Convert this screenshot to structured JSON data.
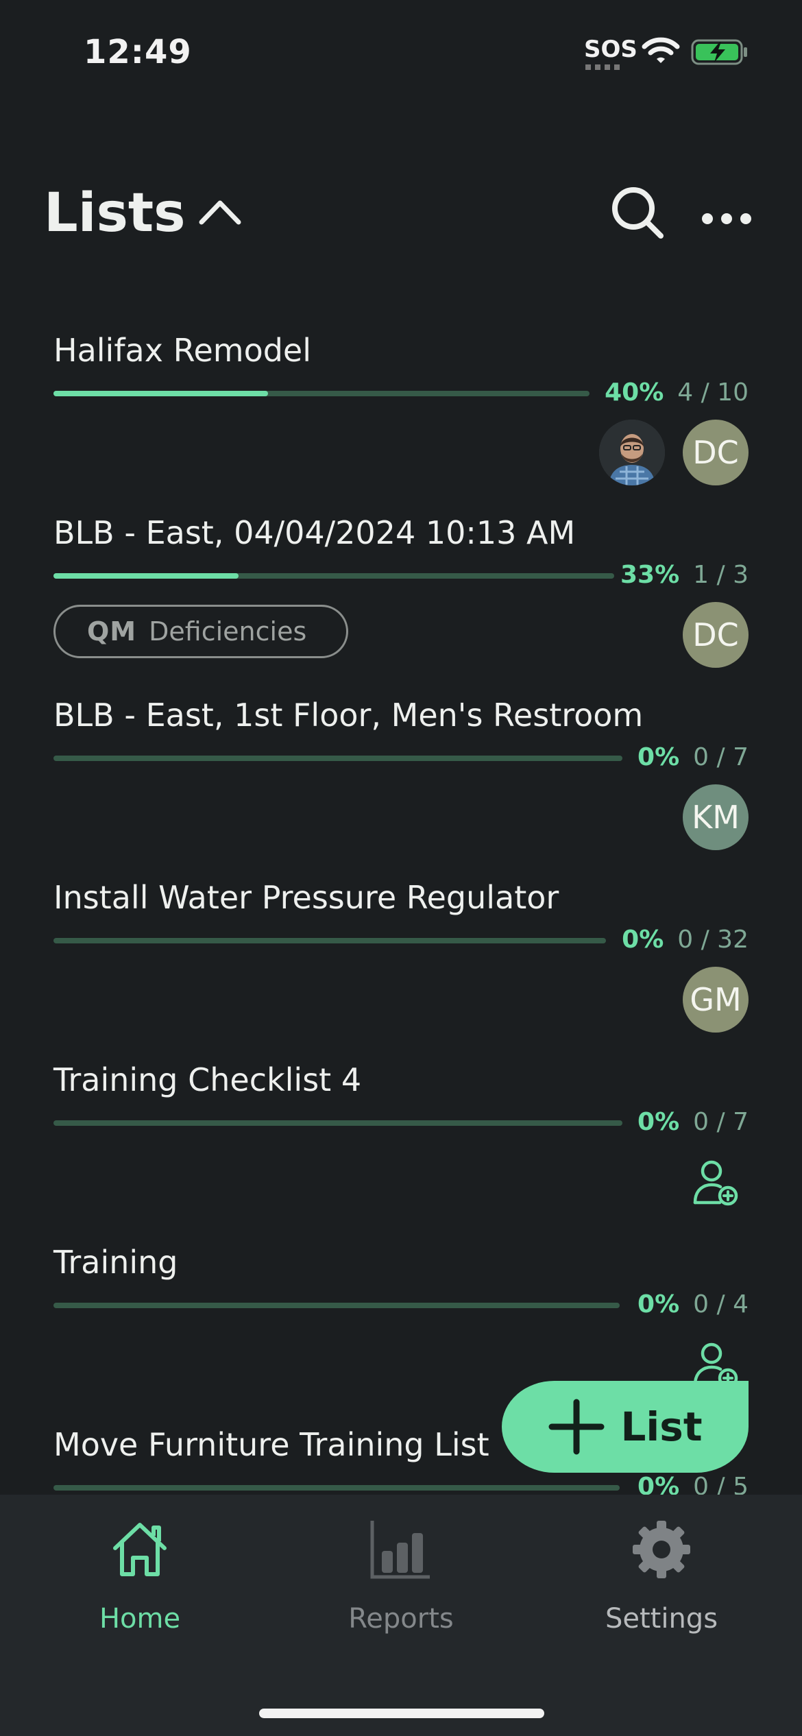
{
  "status_bar": {
    "time": "12:49",
    "carrier": "SOS"
  },
  "header": {
    "title": "Lists"
  },
  "lists": [
    {
      "title": "Halifax Remodel",
      "percent_label": "40%",
      "progress": 0.4,
      "count": "4 / 10",
      "assignees": [
        {
          "type": "photo"
        },
        {
          "type": "initials",
          "text": "DC"
        }
      ]
    },
    {
      "title": "BLB - East, 04/04/2024 10:13 AM",
      "percent_label": "33%",
      "progress": 0.33,
      "count": "1 / 3",
      "tag": {
        "icon": "QM",
        "label": "Deficiencies"
      },
      "assignees": [
        {
          "type": "initials",
          "text": "DC"
        }
      ]
    },
    {
      "title": "BLB - East, 1st Floor, Men's Restroom",
      "percent_label": "0%",
      "progress": 0,
      "count": "0 / 7",
      "assignees": [
        {
          "type": "initials",
          "text": "KM"
        }
      ]
    },
    {
      "title": "Install Water Pressure Regulator",
      "percent_label": "0%",
      "progress": 0,
      "count": "0 / 32",
      "assignees": [
        {
          "type": "initials",
          "text": "GM"
        }
      ]
    },
    {
      "title": "Training Checklist 4",
      "percent_label": "0%",
      "progress": 0,
      "count": "0 / 7",
      "assignees": [
        {
          "type": "add-person"
        }
      ]
    },
    {
      "title": "Training",
      "percent_label": "0%",
      "progress": 0,
      "count": "0 / 4",
      "assignees": [
        {
          "type": "add-person"
        }
      ]
    },
    {
      "title": "Move Furniture Training List",
      "percent_label": "0%",
      "progress": 0,
      "count": "0 / 5"
    }
  ],
  "fab": {
    "label": "List"
  },
  "bottom_nav": [
    {
      "label": "Home",
      "icon": "home-icon",
      "active": true
    },
    {
      "label": "Reports",
      "icon": "bar-chart-icon",
      "active": false
    },
    {
      "label": "Settings",
      "icon": "gear-icon",
      "active": false
    }
  ],
  "colors": {
    "accent": "#6ddea6",
    "background": "#1b1e20",
    "nav_background": "#24282b",
    "track": "#365a48"
  }
}
